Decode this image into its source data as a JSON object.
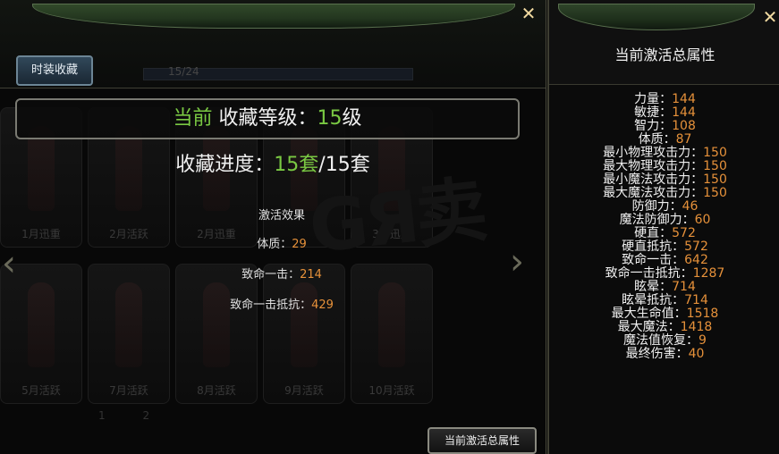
{
  "left_window": {
    "close_glyph": "✕",
    "tab_label": "时装收藏",
    "background_cards": [
      {
        "label": "1月迅重"
      },
      {
        "label": "2月活跃"
      },
      {
        "label": "2月迅重"
      },
      {
        "label": ""
      },
      {
        "label": "3月迅重"
      },
      {
        "label": "5月活跃"
      },
      {
        "label": "7月活跃"
      },
      {
        "label": "8月活跃"
      },
      {
        "label": "9月活跃"
      },
      {
        "label": "10月活跃"
      }
    ],
    "page_numbers": [
      "1",
      "2"
    ],
    "progress_ghost": "15/24",
    "nav_left_glyph": "‹",
    "nav_right_glyph": "›"
  },
  "dialog": {
    "level_prefix": "当前",
    "level_label": "收藏等级：",
    "level_value": "15",
    "level_unit": "级",
    "progress_label": "收藏进度：",
    "progress_current": "15套",
    "progress_total": "/15套",
    "effect_title": "激活效果",
    "effects": [
      {
        "label": "体质：",
        "value": "29"
      },
      {
        "label": "致命一击：",
        "value": "214"
      },
      {
        "label": "致命一击抵抗：",
        "value": "429"
      }
    ],
    "button_label": "当前激活总属性"
  },
  "right_window": {
    "close_glyph": "✕",
    "title": "当前激活总属性",
    "attributes": [
      {
        "label": "力量：",
        "value": "144"
      },
      {
        "label": "敏捷：",
        "value": "144"
      },
      {
        "label": "智力：",
        "value": "108"
      },
      {
        "label": "体质：",
        "value": "87"
      },
      {
        "label": "最小物理攻击力：",
        "value": "150"
      },
      {
        "label": "最大物理攻击力：",
        "value": "150"
      },
      {
        "label": "最小魔法攻击力：",
        "value": "150"
      },
      {
        "label": "最大魔法攻击力：",
        "value": "150"
      },
      {
        "label": "防御力：",
        "value": "46"
      },
      {
        "label": "魔法防御力：",
        "value": "60"
      },
      {
        "label": "硬直：",
        "value": "572"
      },
      {
        "label": "硬直抵抗：",
        "value": "572"
      },
      {
        "label": "致命一击：",
        "value": "642"
      },
      {
        "label": "致命一击抵抗：",
        "value": "1287"
      },
      {
        "label": "眩晕：",
        "value": "714"
      },
      {
        "label": "眩晕抵抗：",
        "value": "714"
      },
      {
        "label": "最大生命值：",
        "value": "1518"
      },
      {
        "label": "最大魔法：",
        "value": "1418"
      },
      {
        "label": "魔法值恢复：",
        "value": "9"
      },
      {
        "label": "最终伤害：",
        "value": "40"
      }
    ]
  },
  "colors": {
    "highlight_green": "#7ac943",
    "value_orange": "#e6913a"
  }
}
